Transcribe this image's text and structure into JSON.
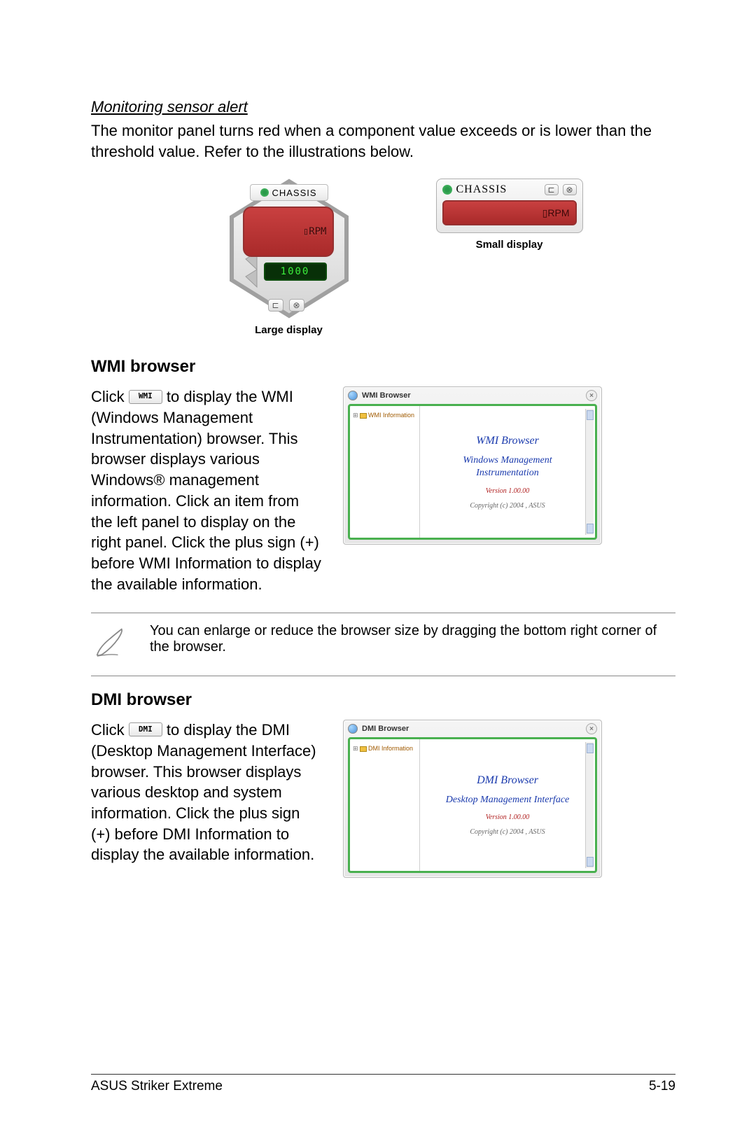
{
  "section1": {
    "title": "Monitoring sensor alert",
    "body": "The monitor panel turns red when a component value exceeds or is lower than the threshold value. Refer to the illustrations below."
  },
  "large_display": {
    "title": "CHASSIS",
    "rpm_label": "RPM",
    "green_lcd": "1000",
    "caption": "Large display"
  },
  "small_display": {
    "title": "CHASSIS",
    "rpm_label": "RPM",
    "caption": "Small display"
  },
  "wmi": {
    "heading": "WMI browser",
    "text_pre": "Click ",
    "btn_label": "WMI",
    "text_post": " to display the WMI (Windows Management Instrumentation) browser. This browser displays various Windows® management information. Click an item from the left panel to display on the right panel. Click the plus sign (+) before WMI Information to display the available information.",
    "win_title": "WMI Browser",
    "tree_label": "WMI Information",
    "panel_title": "WMI  Browser",
    "panel_sub": "Windows Management Instrumentation",
    "version": "Version 1.00.00",
    "copyright": "Copyright (c) 2004 , ASUS"
  },
  "note": {
    "text": "You can enlarge or reduce the browser size by dragging the bottom right corner of the browser."
  },
  "dmi": {
    "heading": "DMI browser",
    "text_pre": "Click ",
    "btn_label": "DMI",
    "text_post": " to display the DMI (Desktop Management Interface) browser. This browser displays various desktop and system information. Click the plus sign (+) before DMI Information to display the available information.",
    "win_title": "DMI Browser",
    "tree_label": "DMI Information",
    "panel_title": "DMI  Browser",
    "panel_sub": "Desktop Management Interface",
    "version": "Version 1.00.00",
    "copyright": "Copyright (c) 2004 , ASUS"
  },
  "footer": {
    "left": "ASUS Striker Extreme",
    "right": "5-19"
  }
}
